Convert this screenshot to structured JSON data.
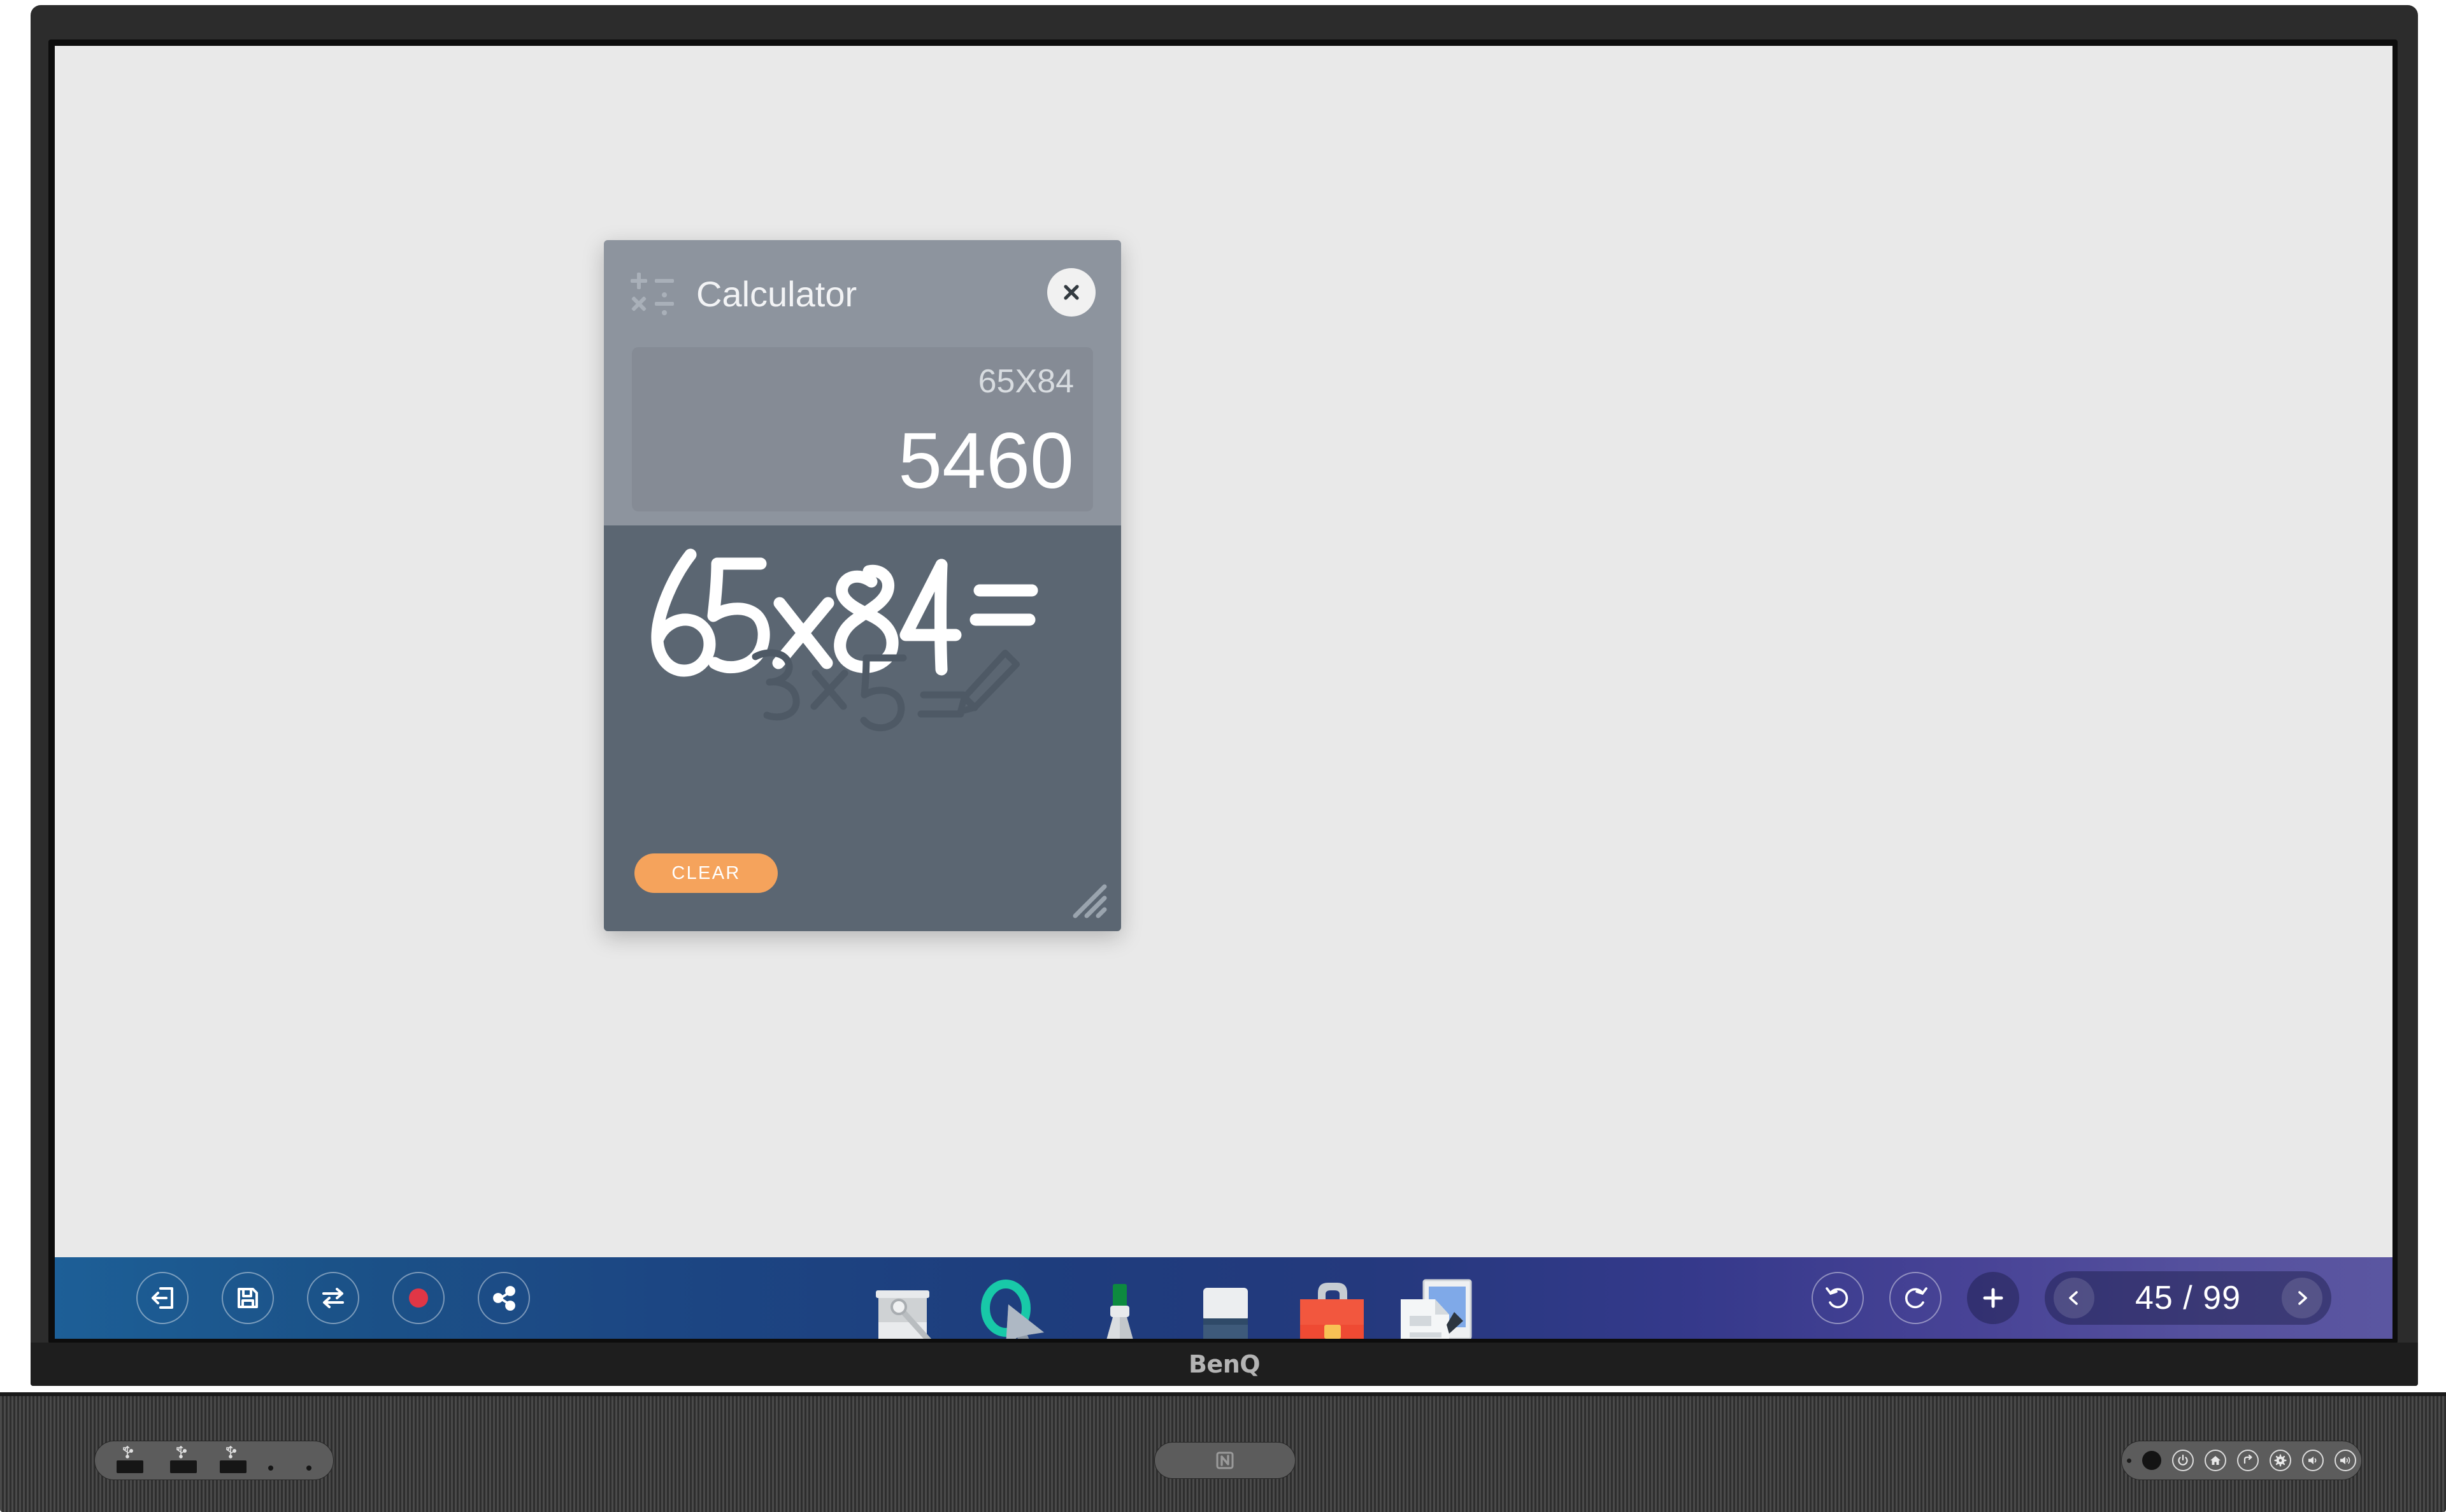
{
  "device": {
    "brand_logo": "BenQ",
    "bezel_color": "#2c2c2c",
    "screen_bg": "#e9e9e9"
  },
  "calculator": {
    "title": "Calculator",
    "app_icon": "calculator-operators-icon",
    "close_icon": "close-icon",
    "expression": "65X84",
    "result": "5460",
    "handwriting_text": "65x84=",
    "hint_text": "3x5=",
    "hint_icon": "pencil-icon",
    "clear_label": "CLEAR",
    "clear_color": "#f5a35c",
    "header_color": "#8d949e",
    "canvas_color": "#5b6672",
    "resize_handle": "resize-grip-icon"
  },
  "taskbar": {
    "left_buttons": [
      {
        "name": "exit-button",
        "icon": "exit-door-icon",
        "label": "Exit"
      },
      {
        "name": "save-button",
        "icon": "floppy-disk-icon",
        "label": "Save"
      },
      {
        "name": "switch-button",
        "icon": "swap-arrows-icon",
        "label": "Switch Source"
      },
      {
        "name": "record-button",
        "icon": "record-dot-icon",
        "label": "Record",
        "color": "#e03646"
      },
      {
        "name": "share-button",
        "icon": "share-nodes-icon",
        "label": "Share"
      }
    ],
    "tools": [
      {
        "name": "tool-eraser",
        "icon": "eraser-bucket-icon",
        "label": "Eraser"
      },
      {
        "name": "tool-select",
        "icon": "lasso-cursor-icon",
        "label": "Select"
      },
      {
        "name": "tool-pen",
        "icon": "marker-pen-icon",
        "label": "Pen"
      },
      {
        "name": "tool-highlighter",
        "icon": "highlighter-icon",
        "label": "Highlighter"
      },
      {
        "name": "tool-toolbox",
        "icon": "briefcase-icon",
        "label": "Toolbox"
      },
      {
        "name": "tool-insert",
        "icon": "insert-image-icon",
        "label": "Insert"
      }
    ],
    "undo_icon": "undo-arrow-icon",
    "undo_label": "Undo",
    "redo_icon": "redo-arrow-icon",
    "redo_label": "Redo",
    "add_page_icon": "plus-icon",
    "add_page_label": "Add page",
    "prev_page_icon": "chevron-left-icon",
    "next_page_icon": "chevron-right-icon",
    "page_indicator": "45 / 99",
    "current_page": 45,
    "total_pages": 99
  },
  "soundbar": {
    "usb_ports": [
      "usb-port-1",
      "usb-port-2",
      "usb-port-3"
    ],
    "nfc_label": "NFC",
    "nfc_icon": "nfc-icon",
    "controls": [
      {
        "name": "ir-receiver",
        "icon": "ir-sensor-icon",
        "label": "IR"
      },
      {
        "name": "power-button",
        "icon": "power-icon",
        "label": "Power"
      },
      {
        "name": "home-button",
        "icon": "home-icon",
        "label": "Home"
      },
      {
        "name": "back-button",
        "icon": "back-arrow-icon",
        "label": "Back"
      },
      {
        "name": "settings-button",
        "icon": "gear-icon",
        "label": "Settings"
      },
      {
        "name": "volume-down-button",
        "icon": "volume-low-icon",
        "label": "Volume Down"
      },
      {
        "name": "volume-up-button",
        "icon": "volume-high-icon",
        "label": "Volume Up"
      }
    ]
  }
}
